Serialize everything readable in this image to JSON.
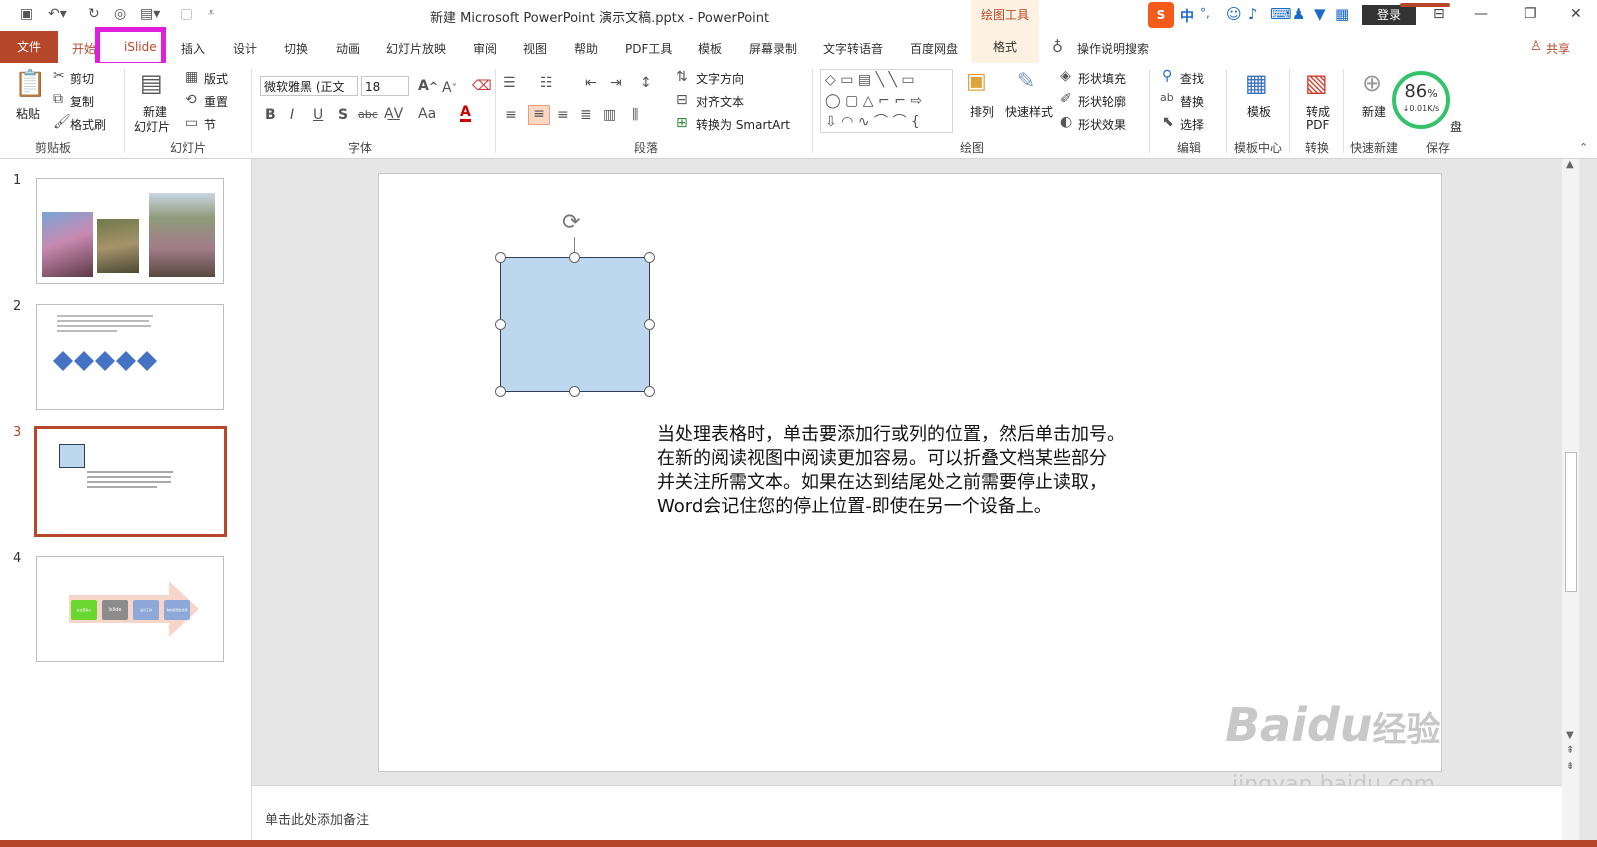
{
  "window": {
    "title": "新建 Microsoft PowerPoint 演示文稿.pptx  -  PowerPoint",
    "context_tab_group": "绘图工具",
    "login_label": "登录",
    "ime": {
      "lang": "中",
      "punct": "°,"
    }
  },
  "tabs": [
    {
      "label": "文件"
    },
    {
      "label": "开始"
    },
    {
      "label": "iSlide"
    },
    {
      "label": "插入"
    },
    {
      "label": "设计"
    },
    {
      "label": "切换"
    },
    {
      "label": "动画"
    },
    {
      "label": "幻灯片放映"
    },
    {
      "label": "审阅"
    },
    {
      "label": "视图"
    },
    {
      "label": "帮助"
    },
    {
      "label": "PDF工具"
    },
    {
      "label": "模板"
    },
    {
      "label": "屏幕录制"
    },
    {
      "label": "文字转语音"
    },
    {
      "label": "百度网盘"
    },
    {
      "label": "格式"
    }
  ],
  "tell_me": "操作说明搜索",
  "share": "共享",
  "ribbon": {
    "clipboard": {
      "paste": "粘贴",
      "cut": "剪切",
      "copy": "复制",
      "format_painter": "格式刷",
      "group": "剪贴板"
    },
    "slides": {
      "new_slide_1": "新建",
      "new_slide_2": "幻灯片",
      "layout": "版式",
      "reset": "重置",
      "section": "节",
      "group": "幻灯片"
    },
    "font": {
      "name": "微软雅黑 (正文",
      "size": "18",
      "group": "字体"
    },
    "paragraph": {
      "text_direction": "文字方向",
      "align_text": "对齐文本",
      "smartart": "转换为 SmartArt",
      "group": "段落"
    },
    "drawing": {
      "arrange": "排列",
      "quick_styles": "快速样式",
      "fill": "形状填充",
      "outline": "形状轮廓",
      "effects": "形状效果",
      "group": "绘图"
    },
    "editing": {
      "find": "查找",
      "replace": "替换",
      "select": "选择",
      "group": "编辑"
    },
    "template_center": {
      "label": "模板",
      "group": "模板中心"
    },
    "convert": {
      "label_1": "转成",
      "label_2": "PDF",
      "group": "转换"
    },
    "quick_new": {
      "label": "新建",
      "group": "快速新建"
    },
    "save": {
      "label": "盘",
      "group": "保存"
    },
    "speed_gauge": {
      "percent": "86",
      "unit": "%",
      "speed": "↓0.01K/s",
      "level": 0.86
    }
  },
  "thumbnails": [
    {
      "number": "1"
    },
    {
      "number": "2"
    },
    {
      "number": "3"
    },
    {
      "number": "4",
      "boxes": [
        "在这里输入",
        "islide",
        "设计工具",
        "你的标题在这里"
      ]
    }
  ],
  "slide": {
    "text_lines": [
      "当处理表格时，单击要添加行或列的位置，然后单击加号。",
      "在新的阅读视图中阅读更加容易。可以折叠文档某些部分",
      "并关注所需文本。如果在达到结尾处之前需要停止读取，",
      "Word会记住您的停止位置-即使在另一个设备上。"
    ]
  },
  "notes_placeholder": "单击此处添加备注",
  "watermark": {
    "brand": "Baidu",
    "suffix": "经验",
    "url": "jingyan.baidu.com"
  },
  "colors": {
    "accent": "#b7472a",
    "shape_fill": "#bdd7ee",
    "shape_border": "#2f3e52",
    "highlight": "#e21edd"
  }
}
